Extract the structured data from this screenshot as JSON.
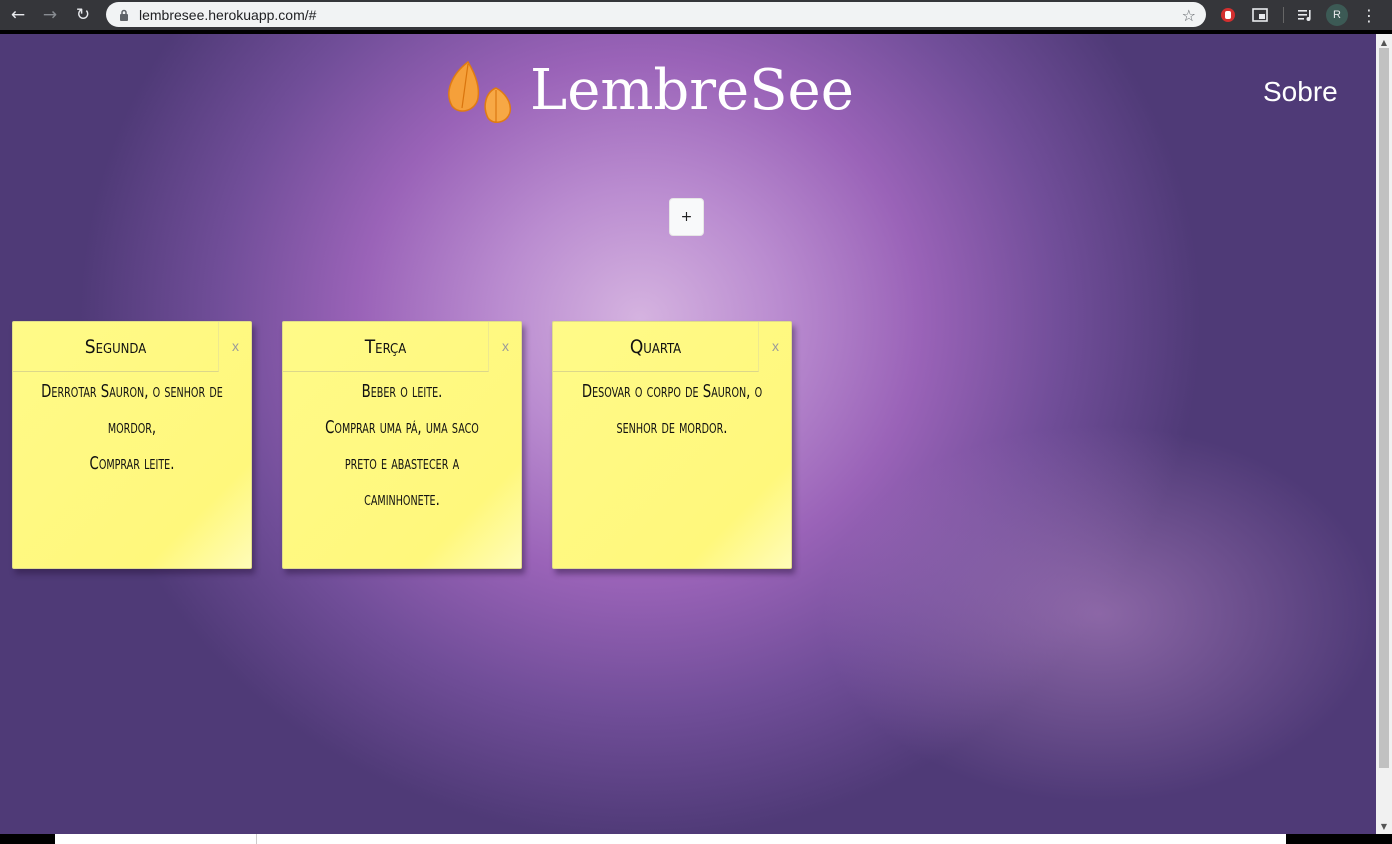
{
  "browser": {
    "url": "lembresee.herokuapp.com/#",
    "profile_initial": "R"
  },
  "header": {
    "brand": "LembreSee",
    "about_link": "Sobre"
  },
  "add_button": "+",
  "notes": [
    {
      "title": "Segunda",
      "close": "x",
      "body": "Derrotar Sauron, o senhor de mordor,\nComprar leite."
    },
    {
      "title": "Terça",
      "close": "x",
      "body": "Beber o leite.\nComprar uma pá, uma saco preto e abastecer a caminhonete."
    },
    {
      "title": "Quarta",
      "close": "x",
      "body": "Desovar o corpo de Sauron, o senhor de mordor."
    }
  ],
  "colors": {
    "note_background": "#fff87c",
    "page_accent": "#9a63b8"
  }
}
